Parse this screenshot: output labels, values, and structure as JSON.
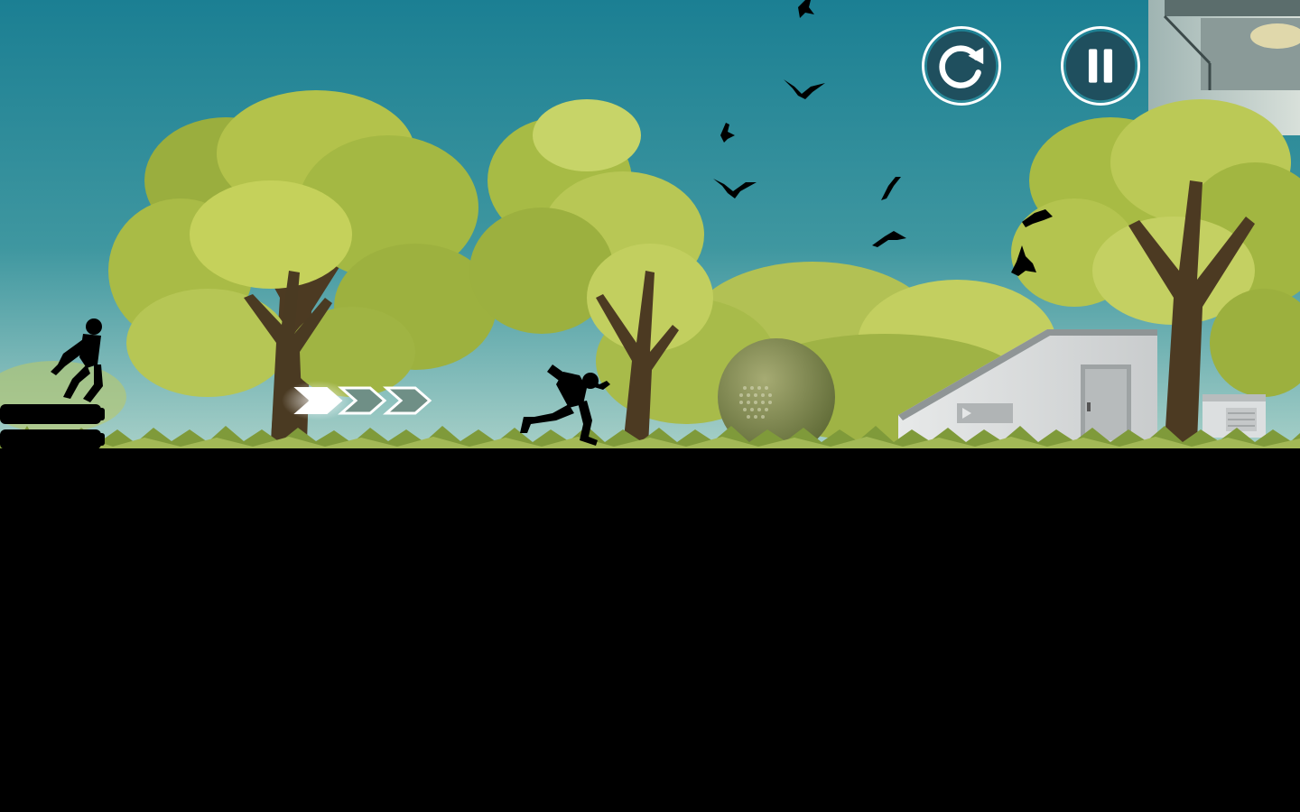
{
  "game": {
    "title": "",
    "hud": {
      "restart_icon": "restart-icon",
      "pause_icon": "pause-icon",
      "button_color": "#1f4f5e",
      "button_border": "#ffffff"
    }
  },
  "scene": {
    "sky_top_color": "#1b7f93",
    "sky_bottom_color": "#a8d0c8",
    "foliage_color": "#a7b53f",
    "ground_color": "#000000",
    "elements": [
      "trees",
      "birds",
      "bunker",
      "sphere",
      "pipes",
      "hunter",
      "runner",
      "boost-arrows"
    ]
  }
}
